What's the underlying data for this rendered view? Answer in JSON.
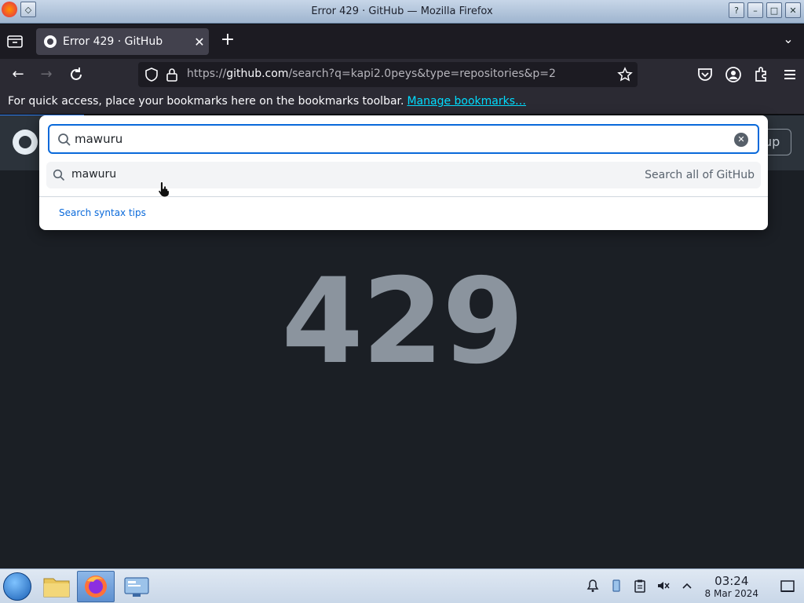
{
  "window": {
    "title": "Error 429 · GitHub — Mozilla Firefox"
  },
  "tabs": [
    {
      "label": "Error 429 · GitHub",
      "active": true
    }
  ],
  "navbar": {
    "url_scheme": "https://",
    "url_host": "github.com",
    "url_path": "/search?q=kapi2.0peys&type=repositories&p=2"
  },
  "bookmarks_bar": {
    "message": "For quick access, place your bookmarks here on the bookmarks toolbar.",
    "link": "Manage bookmarks…"
  },
  "page": {
    "error_code": "429",
    "signup_label_partial": "up"
  },
  "search": {
    "query": "mawuru",
    "suggestion_text": "mawuru",
    "suggestion_hint": "Search all of GitHub",
    "syntax_tips": "Search syntax tips"
  },
  "taskbar": {
    "time": "03:24",
    "date": "8 Mar 2024"
  },
  "colors": {
    "accent": "#0969da",
    "page_bg": "#1b1f25",
    "header_bg": "#2c333b",
    "link_blue": "#00ddff"
  }
}
